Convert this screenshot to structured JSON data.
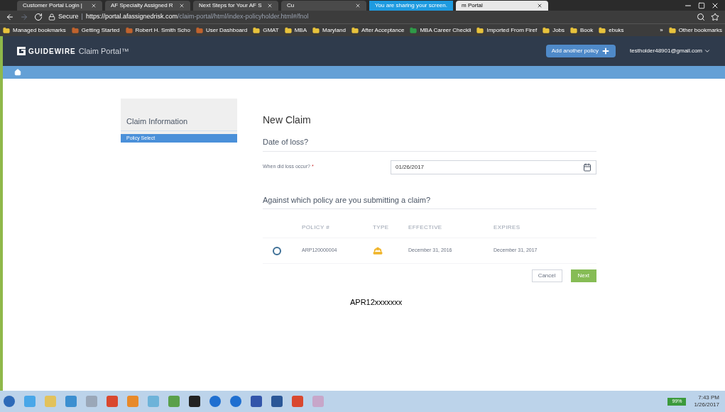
{
  "browser": {
    "tabs": [
      {
        "label": "Customer Portal Login |",
        "selected": false
      },
      {
        "label": "AF Specialty Assigned R",
        "selected": false
      },
      {
        "label": "Next Steps for Your AF S",
        "selected": false
      },
      {
        "label": "Cu",
        "selected": false
      },
      {
        "label": "m Portal",
        "selected": true
      }
    ],
    "sharing_banner": "You are sharing your screen.",
    "address": {
      "secure": "Secure",
      "separator": "|",
      "host": "https://portal.afassignedrisk.com",
      "path": "/claim-portal/html/index-policyholder.html#/fnol"
    },
    "bookmarks": [
      {
        "label": "Managed bookmarks",
        "kind": "folder"
      },
      {
        "label": "Getting Started",
        "kind": "site"
      },
      {
        "label": "Robert H. Smith Scho",
        "kind": "site"
      },
      {
        "label": "User Dashboard",
        "kind": "site"
      },
      {
        "label": "GMAT",
        "kind": "folder"
      },
      {
        "label": "MBA",
        "kind": "folder"
      },
      {
        "label": "Maryland",
        "kind": "folder"
      },
      {
        "label": "After Acceptance",
        "kind": "folder"
      },
      {
        "label": "MBA Career Checkli",
        "kind": "sheet"
      },
      {
        "label": "Imported From Firef",
        "kind": "folder"
      },
      {
        "label": "Jobs",
        "kind": "folder"
      },
      {
        "label": "Book",
        "kind": "folder"
      },
      {
        "label": "ebuks",
        "kind": "folder"
      }
    ],
    "overflow": "»",
    "other_bookmarks": "Other bookmarks"
  },
  "app": {
    "brand": "GUIDEWIRE",
    "product": "Claim Portal™",
    "add_policy": "Add another policy",
    "user": "testholder48901@gmail.com"
  },
  "sidebar": {
    "heading": "Claim Information",
    "items": [
      {
        "label": "Policy Select",
        "selected": true
      }
    ]
  },
  "form": {
    "title": "New Claim",
    "date_section": "Date of loss?",
    "date_label": "When did loss occur?",
    "required": "*",
    "date_value": "01/26/2017",
    "policy_section": "Against which policy are you submitting a claim?",
    "columns": [
      "POLICY #",
      "TYPE",
      "EFFECTIVE",
      "EXPIRES"
    ],
    "rows": [
      {
        "selected": false,
        "policy": "ARP120000004",
        "effective": "December 31, 2016",
        "expires": "December 31, 2017"
      }
    ],
    "cancel": "Cancel",
    "next": "Next"
  },
  "note": "APR12xxxxxxx",
  "taskbar": {
    "battery": "99%",
    "time": "7:43 PM",
    "date": "1/26/2017"
  }
}
